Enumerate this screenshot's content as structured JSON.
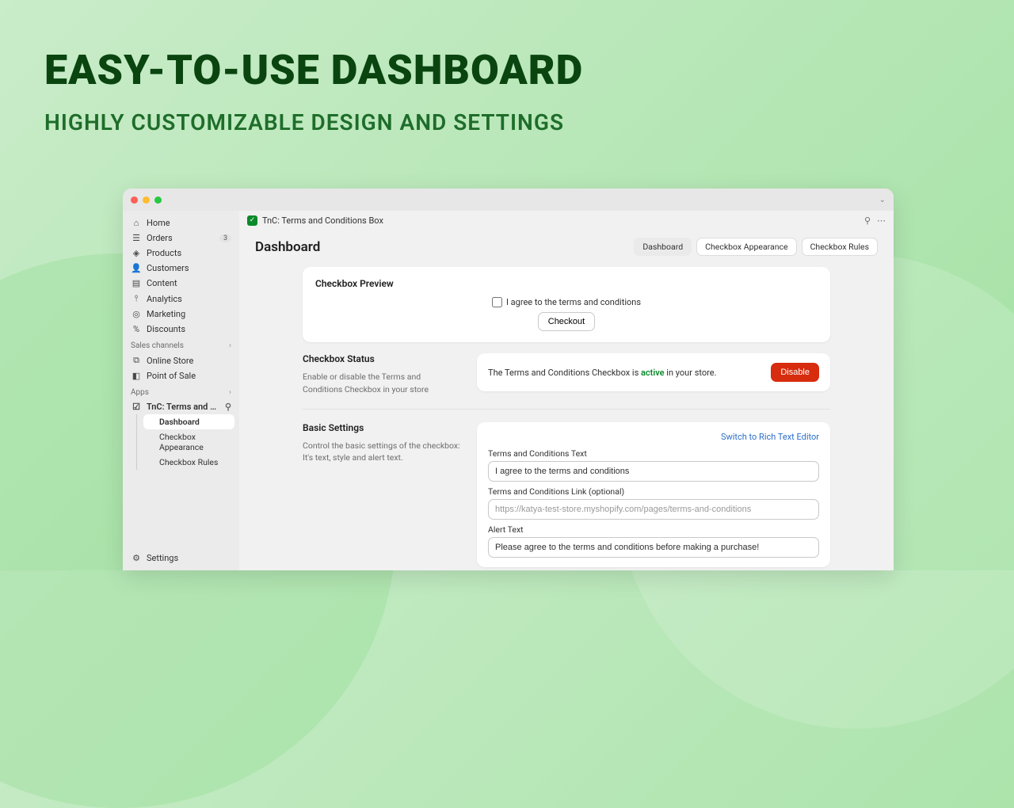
{
  "hero": {
    "title": "EASY-TO-USE DASHBOARD",
    "subtitle": "HIGHLY CUSTOMIZABLE DESIGN AND SETTINGS"
  },
  "app": {
    "name": "TnC: Terms and Conditions Box"
  },
  "sidebar": {
    "items": [
      {
        "icon": "home",
        "label": "Home"
      },
      {
        "icon": "orders",
        "label": "Orders",
        "badge": "3"
      },
      {
        "icon": "products",
        "label": "Products"
      },
      {
        "icon": "customers",
        "label": "Customers"
      },
      {
        "icon": "content",
        "label": "Content"
      },
      {
        "icon": "analytics",
        "label": "Analytics"
      },
      {
        "icon": "marketing",
        "label": "Marketing"
      },
      {
        "icon": "discounts",
        "label": "Discounts"
      }
    ],
    "sales_channels_label": "Sales channels",
    "channels": [
      {
        "icon": "online-store",
        "label": "Online Store"
      },
      {
        "icon": "pos",
        "label": "Point of Sale"
      }
    ],
    "apps_label": "Apps",
    "app_item": {
      "label": "TnC: Terms and Cond..."
    },
    "app_subs": [
      {
        "label": "Dashboard",
        "active": true
      },
      {
        "label": "Checkbox Appearance"
      },
      {
        "label": "Checkbox Rules"
      }
    ],
    "settings_label": "Settings"
  },
  "page": {
    "title": "Dashboard",
    "tabs": [
      {
        "label": "Dashboard",
        "active": true
      },
      {
        "label": "Checkbox Appearance"
      },
      {
        "label": "Checkbox Rules"
      }
    ]
  },
  "preview": {
    "section_title": "Checkbox Preview",
    "agree_text": "I agree to the terms and conditions",
    "checkout_label": "Checkout"
  },
  "status": {
    "section_title": "Checkbox Status",
    "section_desc": "Enable or disable the Terms and Conditions Checkbox in your store",
    "text_before": "The Terms and Conditions Checkbox is ",
    "active_word": "active",
    "text_after": " in your store.",
    "disable_label": "Disable"
  },
  "basic": {
    "section_title": "Basic Settings",
    "section_desc": "Control the basic settings of the checkbox: It's text, style and alert text.",
    "switch_link": "Switch to Rich Text Editor",
    "tc_text_label": "Terms and Conditions Text",
    "tc_text_value": "I agree to the terms and conditions",
    "tc_link_label": "Terms and Conditions Link (optional)",
    "tc_link_placeholder": "https://katya-test-store.myshopify.com/pages/terms-and-conditions",
    "alert_label": "Alert Text",
    "alert_value": "Please agree to the terms and conditions before making a purchase!"
  }
}
